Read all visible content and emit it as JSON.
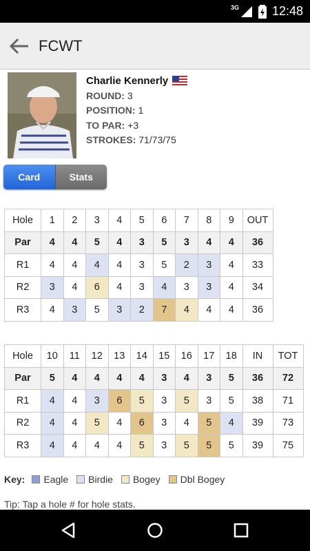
{
  "status": {
    "network": "3G",
    "time": "12:48"
  },
  "appbar": {
    "title": "FCWT"
  },
  "player": {
    "name": "Charlie Kennerly",
    "round_label": "ROUND:",
    "round": "3",
    "position_label": "POSITION:",
    "position": "1",
    "to_par_label": "TO PAR:",
    "to_par": "+3",
    "strokes_label": "STROKES:",
    "strokes": "71/73/75"
  },
  "tabs": {
    "card": "Card",
    "stats": "Stats"
  },
  "front": {
    "header": [
      "Hole",
      "1",
      "2",
      "3",
      "4",
      "5",
      "6",
      "7",
      "8",
      "9",
      "OUT"
    ],
    "rows": [
      {
        "cells": [
          "Par",
          "4",
          "4",
          "5",
          "4",
          "3",
          "5",
          "3",
          "4",
          "4",
          "36"
        ],
        "marks": [
          "",
          "",
          "",
          "",
          "",
          "",
          "",
          "",
          "",
          "",
          ""
        ]
      },
      {
        "cells": [
          "R1",
          "4",
          "4",
          "4",
          "4",
          "3",
          "5",
          "2",
          "3",
          "4",
          "33"
        ],
        "marks": [
          "",
          "",
          "",
          "birdie",
          "",
          "",
          "",
          "birdie",
          "birdie",
          "",
          ""
        ]
      },
      {
        "cells": [
          "R2",
          "3",
          "4",
          "6",
          "4",
          "3",
          "4",
          "3",
          "3",
          "4",
          "34"
        ],
        "marks": [
          "",
          "birdie",
          "",
          "bogey",
          "",
          "",
          "birdie",
          "",
          "birdie",
          "",
          ""
        ]
      },
      {
        "cells": [
          "R3",
          "4",
          "3",
          "5",
          "3",
          "2",
          "7",
          "4",
          "4",
          "4",
          "36"
        ],
        "marks": [
          "",
          "",
          "birdie",
          "",
          "birdie",
          "birdie",
          "dbl",
          "bogey",
          "",
          "",
          ""
        ]
      }
    ]
  },
  "back": {
    "header": [
      "Hole",
      "10",
      "11",
      "12",
      "13",
      "14",
      "15",
      "16",
      "17",
      "18",
      "IN",
      "TOT"
    ],
    "rows": [
      {
        "cells": [
          "Par",
          "5",
          "4",
          "4",
          "4",
          "4",
          "3",
          "4",
          "3",
          "5",
          "36",
          "72"
        ],
        "marks": [
          "",
          "",
          "",
          "",
          "",
          "",
          "",
          "",
          "",
          "",
          "",
          ""
        ]
      },
      {
        "cells": [
          "R1",
          "4",
          "4",
          "3",
          "6",
          "5",
          "3",
          "5",
          "3",
          "5",
          "38",
          "71"
        ],
        "marks": [
          "",
          "birdie",
          "",
          "birdie",
          "dbl",
          "bogey",
          "",
          "bogey",
          "",
          "",
          "",
          ""
        ]
      },
      {
        "cells": [
          "R2",
          "4",
          "4",
          "5",
          "4",
          "6",
          "3",
          "4",
          "5",
          "4",
          "39",
          "73"
        ],
        "marks": [
          "",
          "birdie",
          "",
          "bogey",
          "",
          "dbl",
          "",
          "",
          "dbl",
          "birdie",
          "",
          ""
        ]
      },
      {
        "cells": [
          "R3",
          "4",
          "4",
          "4",
          "4",
          "5",
          "3",
          "5",
          "5",
          "5",
          "39",
          "75"
        ],
        "marks": [
          "",
          "birdie",
          "",
          "",
          "",
          "bogey",
          "",
          "bogey",
          "dbl",
          "",
          "",
          ""
        ]
      }
    ]
  },
  "key": {
    "label": "Key:",
    "items": [
      {
        "name": "Eagle",
        "color": "#8ba0d8"
      },
      {
        "name": "Birdie",
        "color": "#dde2f2"
      },
      {
        "name": "Bogey",
        "color": "#f3e8c4"
      },
      {
        "name": "Dbl Bogey",
        "color": "#e2c58a"
      }
    ]
  },
  "tip": "Tip: Tap a hole # for hole stats.",
  "icons": {
    "back": "arrow-left-icon",
    "flag": "us-flag-icon",
    "nav_back": "triangle-back-icon",
    "nav_home": "circle-home-icon",
    "nav_recent": "square-recent-icon"
  }
}
